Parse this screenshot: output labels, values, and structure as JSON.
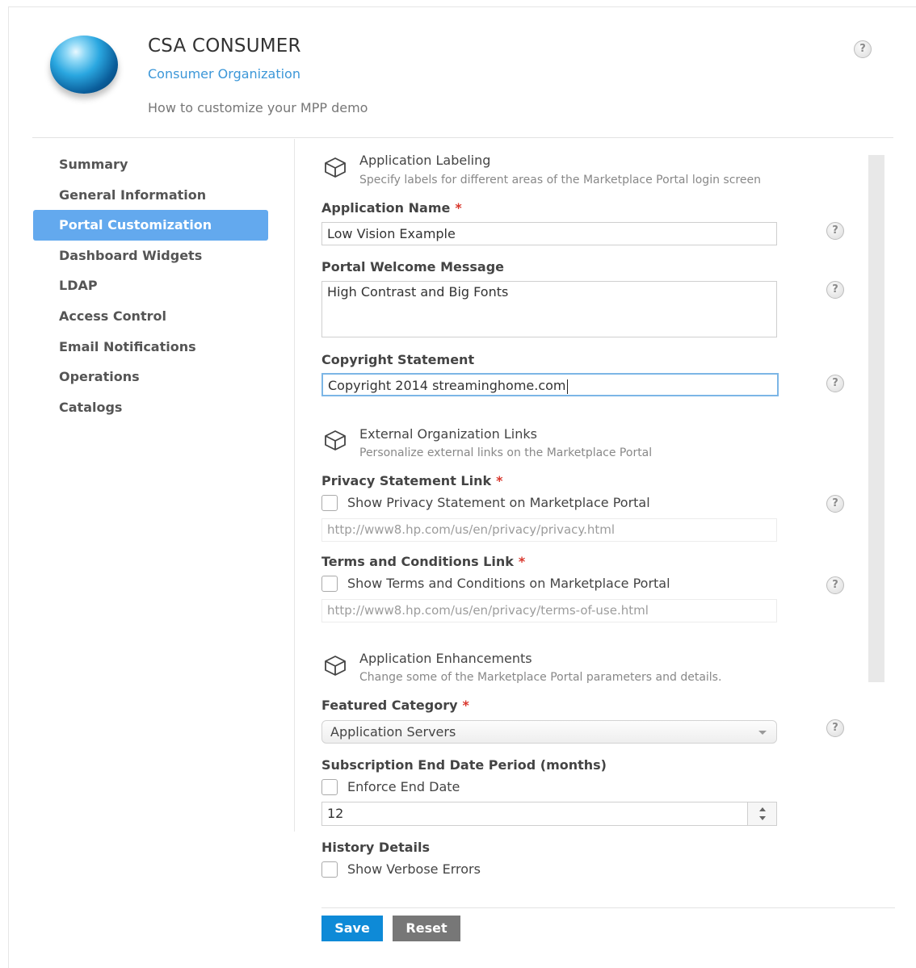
{
  "header": {
    "title": "CSA CONSUMER",
    "org_link": "Consumer Organization",
    "description": "How to customize your MPP demo"
  },
  "sidebar": {
    "items": [
      {
        "label": "Summary"
      },
      {
        "label": "General Information"
      },
      {
        "label": "Portal Customization",
        "active": true
      },
      {
        "label": "Dashboard Widgets"
      },
      {
        "label": "LDAP"
      },
      {
        "label": "Access Control"
      },
      {
        "label": "Email Notifications"
      },
      {
        "label": "Operations"
      },
      {
        "label": "Catalogs"
      }
    ]
  },
  "sections": {
    "labeling": {
      "title": "Application Labeling",
      "subtitle": "Specify labels for different areas of the Marketplace Portal login screen"
    },
    "links": {
      "title": "External Organization Links",
      "subtitle": "Personalize external links on the Marketplace Portal"
    },
    "enhancements": {
      "title": "Application Enhancements",
      "subtitle": "Change some of the Marketplace Portal parameters and details."
    }
  },
  "form": {
    "app_name": {
      "label": "Application Name",
      "required": "*",
      "value": "Low Vision Example"
    },
    "welcome": {
      "label": "Portal Welcome Message",
      "value": "High Contrast and Big Fonts"
    },
    "copyright": {
      "label": "Copyright Statement",
      "value": "Copyright 2014 streaminghome.com"
    },
    "privacy": {
      "label": "Privacy Statement Link",
      "required": "*",
      "checkbox_label": "Show Privacy Statement on Marketplace Portal",
      "checked": false,
      "url": "http://www8.hp.com/us/en/privacy/privacy.html"
    },
    "terms": {
      "label": "Terms and Conditions Link",
      "required": "*",
      "checkbox_label": "Show Terms and Conditions on Marketplace Portal",
      "checked": false,
      "url": "http://www8.hp.com/us/en/privacy/terms-of-use.html"
    },
    "featured": {
      "label": "Featured Category",
      "required": "*",
      "value": "Application Servers"
    },
    "subscription": {
      "label": "Subscription End Date Period (months)",
      "checkbox_label": "Enforce End Date",
      "checked": false,
      "value": "12"
    },
    "history": {
      "label": "History Details",
      "checkbox_label": "Show Verbose Errors",
      "checked": false
    }
  },
  "actions": {
    "save": "Save",
    "reset": "Reset"
  },
  "help_glyph": "?",
  "colors": {
    "accent": "#63a9ee",
    "link": "#3c97d8",
    "save": "#0e8ad7",
    "reset": "#777777",
    "required": "#d9372d"
  }
}
